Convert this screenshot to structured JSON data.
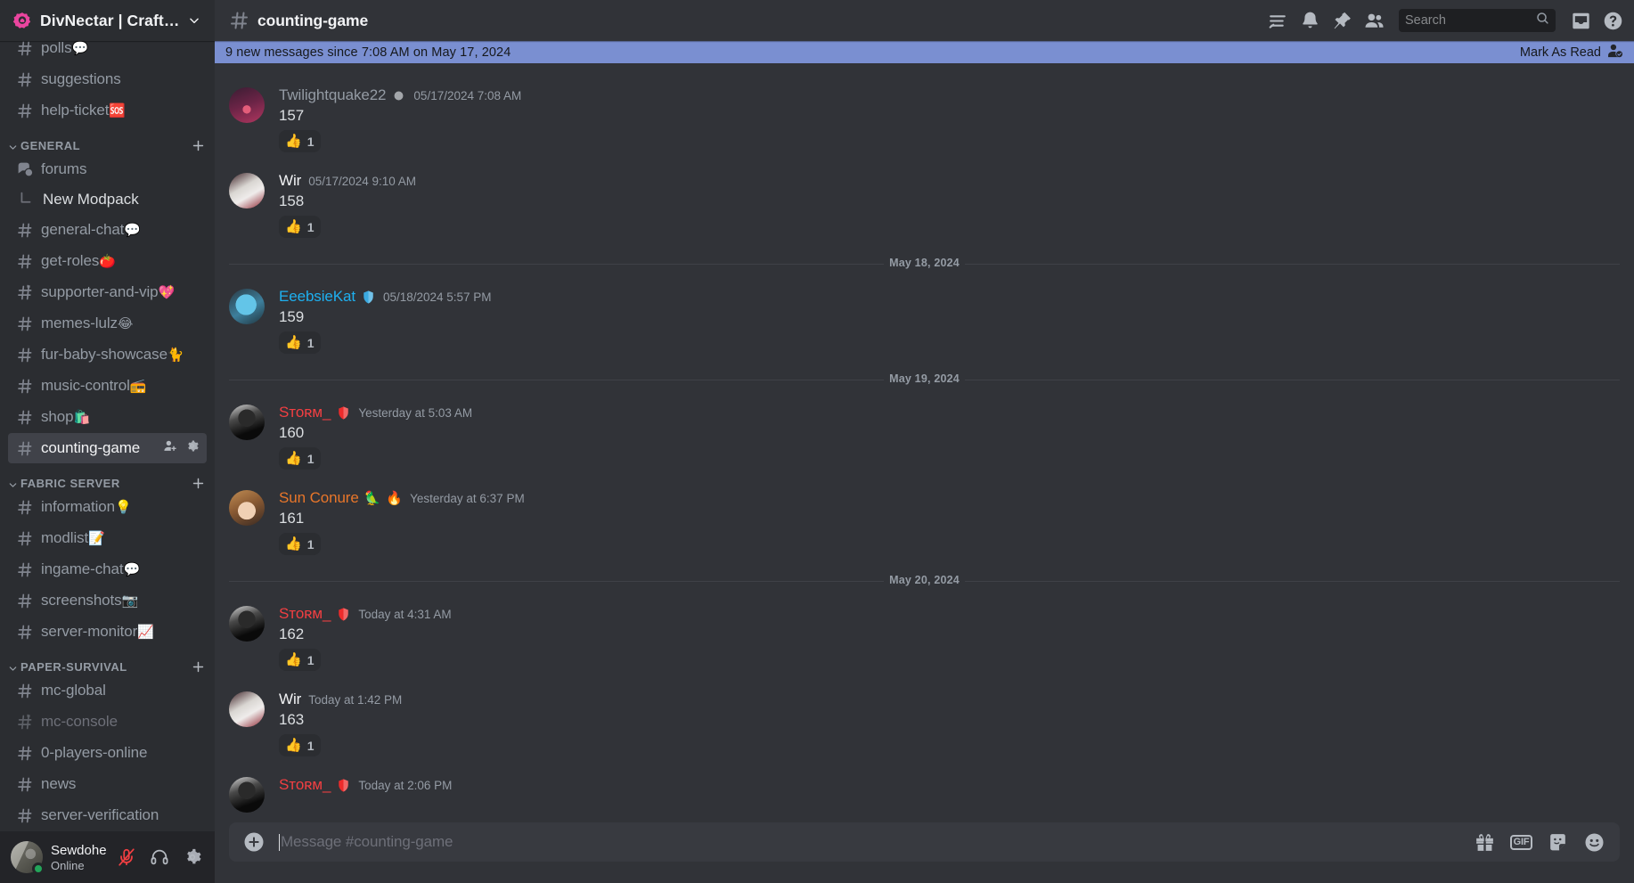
{
  "server": {
    "name": "DivNectar | CraftNec...",
    "logo_icon": "server-logo-icon",
    "chevron_icon": "chevron-down-icon"
  },
  "sidebar": {
    "top_channels": [
      {
        "name": "polls",
        "emoji": "💬",
        "icon": "hash-icon",
        "muted": false,
        "locked": false
      },
      {
        "name": "suggestions",
        "emoji": "",
        "icon": "hash-icon",
        "muted": false,
        "locked": false
      },
      {
        "name": "help-ticket",
        "emoji": "🆘",
        "icon": "hash-icon",
        "muted": false,
        "locked": false
      }
    ],
    "categories": [
      {
        "label": "GENERAL",
        "add_icon": "plus-icon",
        "arrow_icon": "chevron-down-icon",
        "channels": [
          {
            "name": "forums",
            "emoji": "",
            "icon": "forum-icon",
            "muted": false,
            "locked": false
          },
          {
            "name": "New Modpack",
            "emoji": "",
            "icon": "thread-icon",
            "type": "thread"
          },
          {
            "name": "general-chat",
            "emoji": "💬",
            "icon": "hash-icon",
            "muted": false,
            "locked": false
          },
          {
            "name": "get-roles",
            "emoji": "🍅",
            "icon": "hash-icon",
            "muted": false,
            "locked": false
          },
          {
            "name": "supporter-and-vip",
            "emoji": "💖",
            "icon": "hash-lock-icon",
            "muted": false,
            "locked": true
          },
          {
            "name": "memes-lulz",
            "emoji": "😂",
            "icon": "hash-icon",
            "muted": false,
            "locked": false
          },
          {
            "name": "fur-baby-showcase",
            "emoji": "🐈",
            "icon": "hash-icon",
            "muted": false,
            "locked": false
          },
          {
            "name": "music-control",
            "emoji": "📻",
            "icon": "hash-icon",
            "muted": false,
            "locked": false
          },
          {
            "name": "shop",
            "emoji": "🛍️",
            "icon": "hash-icon",
            "muted": false,
            "locked": false
          },
          {
            "name": "counting-game",
            "emoji": "",
            "icon": "hash-icon",
            "active": true,
            "actions": [
              "add-member-icon",
              "gear-icon"
            ]
          }
        ]
      },
      {
        "label": "FABRIC SERVER",
        "add_icon": "plus-icon",
        "arrow_icon": "chevron-down-icon",
        "channels": [
          {
            "name": "information",
            "emoji": "💡",
            "icon": "hash-icon",
            "muted": false,
            "locked": false
          },
          {
            "name": "modlist",
            "emoji": "📝",
            "icon": "hash-icon",
            "muted": false,
            "locked": false
          },
          {
            "name": "ingame-chat",
            "emoji": "💬",
            "icon": "hash-icon",
            "muted": false,
            "locked": false
          },
          {
            "name": "screenshots",
            "emoji": "📷",
            "icon": "hash-icon",
            "muted": false,
            "locked": false
          },
          {
            "name": "server-monitor",
            "emoji": "📈",
            "icon": "hash-icon",
            "muted": false,
            "locked": false
          }
        ]
      },
      {
        "label": "PAPER-SURVIVAL",
        "add_icon": "plus-icon",
        "arrow_icon": "chevron-down-icon",
        "channels": [
          {
            "name": "mc-global",
            "emoji": "",
            "icon": "hash-icon",
            "muted": false,
            "locked": false
          },
          {
            "name": "mc-console",
            "emoji": "",
            "icon": "hash-lock-icon",
            "muted": true,
            "locked": true
          },
          {
            "name": "0-players-online",
            "emoji": "",
            "icon": "hash-icon",
            "muted": false,
            "locked": false
          },
          {
            "name": "news",
            "emoji": "",
            "icon": "hash-icon",
            "muted": false,
            "locked": false
          },
          {
            "name": "server-verification",
            "emoji": "",
            "icon": "hash-icon",
            "muted": false,
            "locked": false
          }
        ]
      }
    ]
  },
  "user_panel": {
    "name": "Sewdohe",
    "status": "Online",
    "status_color": "#23a55a",
    "buttons": [
      {
        "icon": "mic-muted-icon",
        "label": "Mute"
      },
      {
        "icon": "headphones-icon",
        "label": "Deafen"
      },
      {
        "icon": "gear-icon",
        "label": "User Settings"
      }
    ]
  },
  "topbar": {
    "hash_icon": "hash-icon",
    "channel": "counting-game",
    "icons": [
      {
        "icon": "threads-icon",
        "label": "Threads"
      },
      {
        "icon": "bell-icon",
        "label": "Notification Settings"
      },
      {
        "icon": "pin-icon",
        "label": "Pinned Messages"
      },
      {
        "icon": "members-icon",
        "label": "Member List"
      }
    ],
    "search": {
      "placeholder": "Search",
      "value": "",
      "icon": "search-icon"
    },
    "right_icons": [
      {
        "icon": "inbox-icon",
        "label": "Inbox"
      },
      {
        "icon": "help-icon",
        "label": "Help"
      }
    ]
  },
  "new_messages_bar": {
    "text": "9 new messages since 7:08 AM on May 17, 2024",
    "action_label": "Mark As Read",
    "action_icon": "mark-read-icon",
    "background": "#7a8fd1"
  },
  "messages": [
    {
      "type": "message",
      "author": "Twilightquake22",
      "author_color": "#949ba4",
      "badges": [
        {
          "kind": "dot",
          "color": "#a3a6aa"
        }
      ],
      "timestamp": "05/17/2024 7:08 AM",
      "text": "157",
      "avatar_class": "av-tq",
      "reactions": [
        {
          "emoji": "👍",
          "count": "1"
        }
      ]
    },
    {
      "type": "message",
      "author": "Wir",
      "author_color": "#f2f3f5",
      "badges": [],
      "timestamp": "05/17/2024 9:10 AM",
      "text": "158",
      "avatar_class": "av-wir",
      "reactions": [
        {
          "emoji": "👍",
          "count": "1"
        }
      ]
    },
    {
      "type": "divider",
      "label": "May 18, 2024"
    },
    {
      "type": "message",
      "author": "EeebsieKat",
      "author_color": "#1eb0f0",
      "badges": [
        {
          "kind": "shield",
          "color": "#3ba9e0"
        }
      ],
      "timestamp": "05/18/2024 5:57 PM",
      "text": "159",
      "avatar_class": "av-kat",
      "reactions": [
        {
          "emoji": "👍",
          "count": "1"
        }
      ]
    },
    {
      "type": "divider",
      "label": "May 19, 2024"
    },
    {
      "type": "message",
      "author": "Sᴛᴏʀᴍ_",
      "author_color": "#f23f42",
      "badges": [
        {
          "kind": "shield",
          "color": "#ed2b2b"
        }
      ],
      "timestamp": "Yesterday at 5:03 AM",
      "text": "160",
      "avatar_class": "av-storm",
      "reactions": [
        {
          "emoji": "👍",
          "count": "1"
        }
      ]
    },
    {
      "type": "message",
      "author": "Sun Conure",
      "author_color": "#e8762a",
      "badges": [
        {
          "kind": "emoji",
          "glyph": "🦜"
        },
        {
          "kind": "emoji",
          "glyph": "🔥"
        }
      ],
      "timestamp": "Yesterday at 6:37 PM",
      "text": "161",
      "avatar_class": "av-sun",
      "reactions": [
        {
          "emoji": "👍",
          "count": "1"
        }
      ]
    },
    {
      "type": "divider",
      "label": "May 20, 2024"
    },
    {
      "type": "message",
      "author": "Sᴛᴏʀᴍ_",
      "author_color": "#f23f42",
      "badges": [
        {
          "kind": "shield",
          "color": "#ed2b2b"
        }
      ],
      "timestamp": "Today at 4:31 AM",
      "text": "162",
      "avatar_class": "av-storm",
      "reactions": [
        {
          "emoji": "👍",
          "count": "1"
        }
      ]
    },
    {
      "type": "message",
      "author": "Wir",
      "author_color": "#f2f3f5",
      "badges": [],
      "timestamp": "Today at 1:42 PM",
      "text": "163",
      "avatar_class": "av-wir",
      "reactions": [
        {
          "emoji": "👍",
          "count": "1"
        }
      ]
    },
    {
      "type": "message",
      "author": "Sᴛᴏʀᴍ_",
      "author_color": "#f23f42",
      "badges": [
        {
          "kind": "shield",
          "color": "#ed2b2b"
        }
      ],
      "timestamp": "Today at 2:06 PM",
      "text": "",
      "avatar_class": "av-storm",
      "reactions": [],
      "partial": true
    }
  ],
  "composer": {
    "plus_icon": "plus-circle-icon",
    "placeholder": "Message #counting-game",
    "value": "",
    "icons": [
      {
        "icon": "gift-icon",
        "label": "Gift"
      },
      {
        "icon": "gif-icon",
        "label": "GIF"
      },
      {
        "icon": "sticker-icon",
        "label": "Sticker"
      },
      {
        "icon": "emoji-icon",
        "label": "Emoji"
      }
    ]
  }
}
